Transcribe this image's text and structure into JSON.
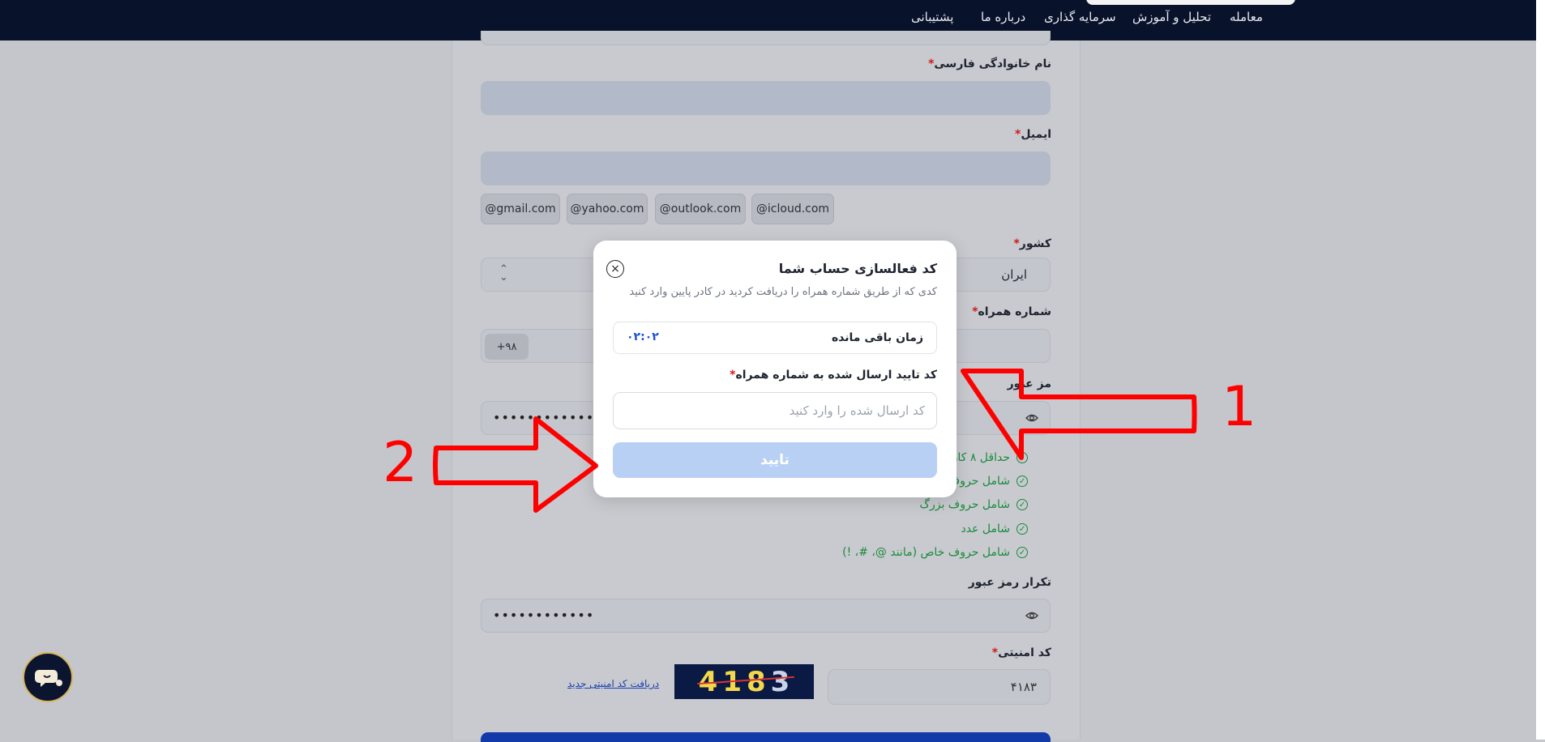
{
  "nav": {
    "items": [
      "معامله",
      "تحلیل و آموزش",
      "سرمایه گذاری",
      "درباره ما",
      "پشتیبانی"
    ]
  },
  "form": {
    "last_name_label": "نام خانوادگی فارسی",
    "email_label": "ایمیل",
    "email_suggestions": [
      "@gmail.com",
      "@yahoo.com",
      "@outlook.com",
      "@icloud.com"
    ],
    "country_label": "کشور",
    "country_value": "ایران",
    "mobile_label": "شماره همراه",
    "mobile_prefix": "+۹۸",
    "password_label": "مز عبور",
    "password_dots": "••••••••••••",
    "rules": [
      "حداقل ۸ کاراکتر",
      "شامل حروف کوچ",
      "شامل حروف بزرگ",
      "شامل عدد",
      "شامل حروف خاص (مانند @، #، !)"
    ],
    "confirm_password_label": "تکرار رمز عبور",
    "confirm_password_dots": "••••••••••••",
    "captcha_label": "کد امنیتی",
    "captcha_value": "۴۱۸۳",
    "captcha_digits": [
      "4",
      "1",
      "8",
      "3"
    ],
    "captcha_refresh": "دریافت کد امنیتی جدید",
    "required_mark": "*"
  },
  "modal": {
    "title": "کد فعالسازی حساب شما",
    "subtitle": "کدی که از طریق شماره همراه را دریافت کردید در کادر پایین وارد کنید",
    "timer_label": "زمان باقی مانده",
    "timer_value": "۰۲:۰۲",
    "code_label": "کد تایید ارسال شده به شماره همراه",
    "code_placeholder": "کد ارسال شده را وارد کنید",
    "confirm_label": "تایید"
  },
  "annotations": {
    "label_1": "1",
    "label_2": "2",
    "color": "#ff0000"
  },
  "colors": {
    "nav_bg": "#09122b",
    "primary_blue": "#1a4fd6",
    "disabled_button": "#b9d0f5",
    "success_green": "#1a8a3c"
  }
}
